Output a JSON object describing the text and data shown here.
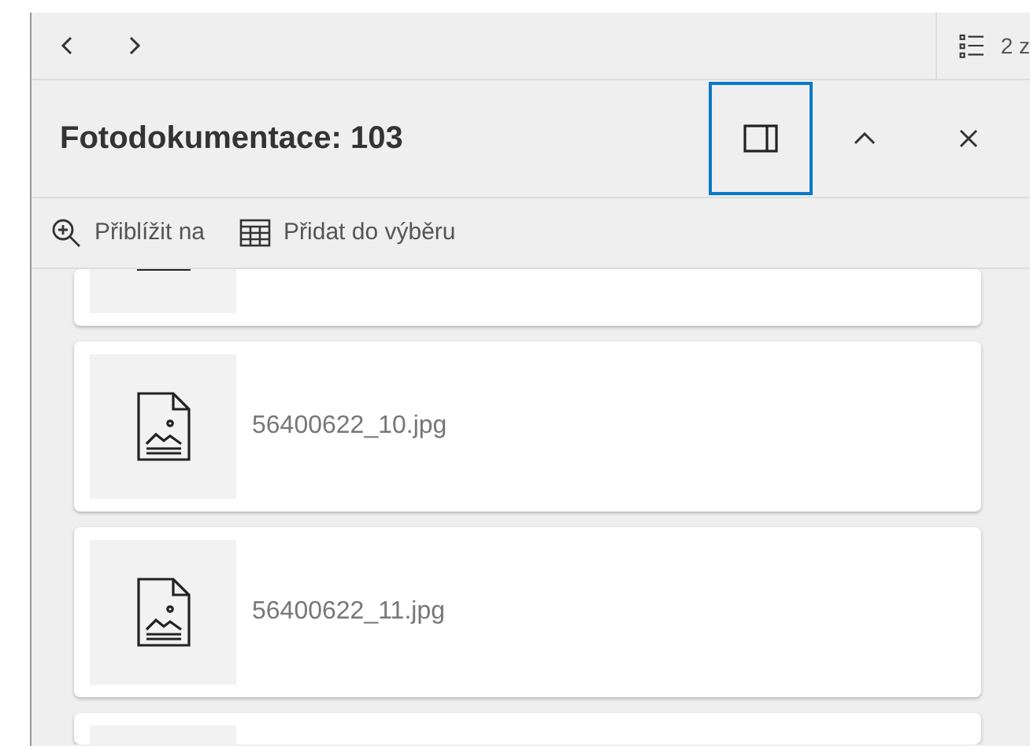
{
  "nav": {
    "counter": "2 z"
  },
  "header": {
    "title": "Fotodokumentace: 103",
    "actions": [
      {
        "kind": "dock",
        "focused": true
      },
      {
        "kind": "collapse",
        "focused": false
      },
      {
        "kind": "close",
        "focused": false
      }
    ]
  },
  "toolbar": [
    {
      "kind": "zoom",
      "label": "Přiblížit na"
    },
    {
      "kind": "table",
      "label": "Přidat do výběru"
    }
  ],
  "files": [
    {
      "name": "56400622_10.jpg"
    },
    {
      "name": "56400622_11.jpg"
    }
  ]
}
